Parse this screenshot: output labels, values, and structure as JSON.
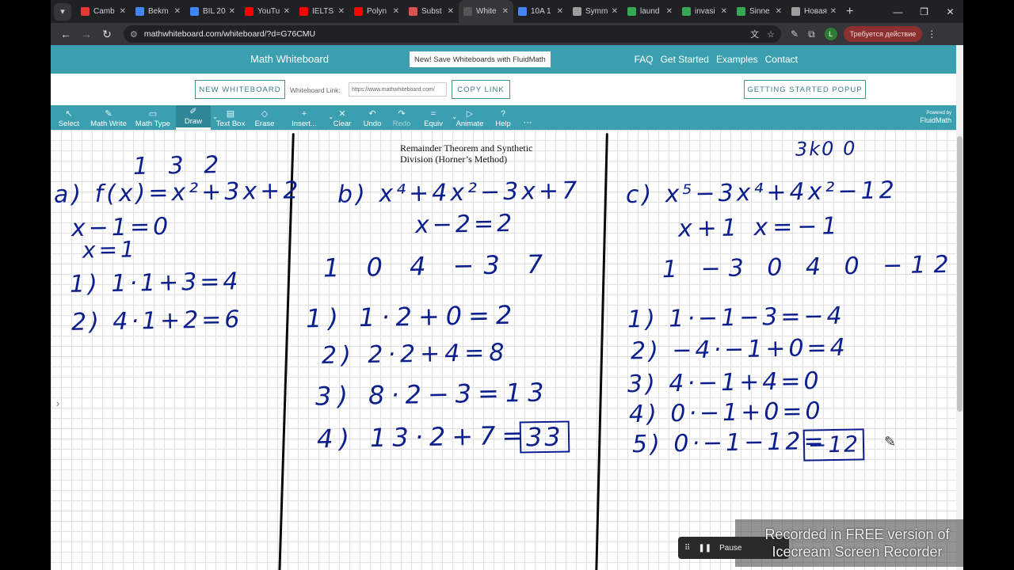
{
  "browser": {
    "tabs": [
      {
        "title": "Camb",
        "color": "#e53935",
        "active": false
      },
      {
        "title": "Bekm",
        "color": "#4285f4",
        "active": false
      },
      {
        "title": "BIL 20",
        "color": "#4285f4",
        "active": false
      },
      {
        "title": "YouTu",
        "color": "#ff0000",
        "active": false
      },
      {
        "title": "IELTS",
        "color": "#ff0000",
        "active": false
      },
      {
        "title": "Polyn",
        "color": "#ff0000",
        "active": false
      },
      {
        "title": "Subst",
        "color": "#d9534f",
        "active": false
      },
      {
        "title": "White",
        "color": "#555555",
        "active": true
      },
      {
        "title": "10A 1",
        "color": "#4285f4",
        "active": false
      },
      {
        "title": "Symm",
        "color": "#9e9e9e",
        "active": false
      },
      {
        "title": "laund",
        "color": "#34a853",
        "active": false
      },
      {
        "title": "invasi",
        "color": "#34a853",
        "active": false
      },
      {
        "title": "Sinne",
        "color": "#34a853",
        "active": false
      },
      {
        "title": "Новая",
        "color": "#9e9e9e",
        "active": false
      }
    ],
    "new_tab": "+",
    "url": "mathwhiteboard.com/whiteboard/?d=G76CMU",
    "profile_initial": "L",
    "action_label": "Требуется действие"
  },
  "site": {
    "title": "Math Whiteboard",
    "promo": "New! Save Whiteboards with FluidMath",
    "nav": [
      "FAQ",
      "Get Started",
      "Examples",
      "Contact"
    ],
    "new_whiteboard": "NEW WHITEBOARD",
    "whiteboard_link_label": "Whiteboard Link:",
    "whiteboard_link_value": "https://www.mathwhiteboard.com/",
    "copy_link": "COPY LINK",
    "getting_started": "GETTING STARTED POPUP"
  },
  "toolbar": {
    "tools": [
      {
        "label": "Select",
        "icon": "↖",
        "active": false,
        "disabled": false
      },
      {
        "label": "Math Write",
        "icon": "✎",
        "active": false,
        "disabled": false
      },
      {
        "label": "Math Type",
        "icon": "▭",
        "active": false,
        "disabled": false
      },
      {
        "label": "Draw",
        "icon": "✐",
        "active": true,
        "disabled": false
      },
      {
        "label": "Text Box",
        "icon": "▤",
        "active": false,
        "disabled": false
      },
      {
        "label": "Erase",
        "icon": "◇",
        "active": false,
        "disabled": false
      },
      {
        "label": "Insert...",
        "icon": "+",
        "active": false,
        "disabled": false
      },
      {
        "label": "Clear",
        "icon": "✕",
        "active": false,
        "disabled": false
      },
      {
        "label": "Undo",
        "icon": "↶",
        "active": false,
        "disabled": false
      },
      {
        "label": "Redo",
        "icon": "↷",
        "active": false,
        "disabled": true
      },
      {
        "label": "Equiv",
        "icon": "=",
        "active": false,
        "disabled": false
      },
      {
        "label": "Animate",
        "icon": "▷",
        "active": false,
        "disabled": false
      },
      {
        "label": "Help",
        "icon": "?",
        "active": false,
        "disabled": false
      },
      {
        "label": "",
        "icon": "⋯",
        "active": false,
        "disabled": false
      }
    ],
    "powered_by": "Powered by",
    "brand": "FluidMath"
  },
  "canvas": {
    "textbox": "Remainder Theorem and Synthetic Division (Horner’s Method)",
    "left_col": [
      "1   3   2",
      "a) f(x)=x²+3x+2",
      "x−1=0",
      "x=1",
      "1) 1·1+3=4",
      "2) 4·1+2=6"
    ],
    "mid_col": [
      "b) x⁴+4x²−3x+7",
      "x−2=2",
      "1   0   4   −3   7",
      "1) 1·2+0=2",
      "2) 2·2+4=8",
      "3) 8·2−3=13",
      "4) 13·2+7=",
      "33"
    ],
    "right_col": [
      "3k0  0",
      "c) x⁵−3x⁴+4x²−12",
      "x+1  x=−1",
      "1   −3   0   4   0  −12",
      "1) 1·−1−3=−4",
      "2) −4·−1+0=4",
      "3) 4·−1+4=0",
      "4) 0·−1+0=0",
      "5) 0·−1−12=",
      "−12"
    ]
  },
  "recorder": {
    "pause": "Pause",
    "watermark_line1": "Recorded in FREE version of",
    "watermark_line2": "Icecream Screen Recorder"
  }
}
